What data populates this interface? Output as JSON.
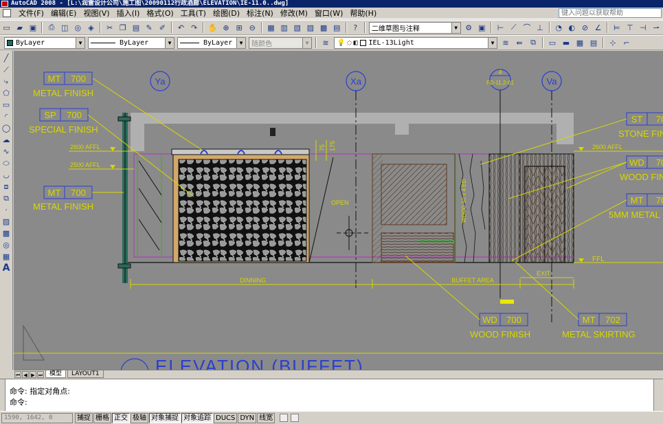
{
  "window": {
    "title": "AutoCAD 2008 - [L:\\润雷设计公司\\施工图\\20090112行政酒廊\\ELEVATION\\IE-11.0..dwg]"
  },
  "menu": [
    {
      "label": "文件(F)"
    },
    {
      "label": "编辑(E)"
    },
    {
      "label": "视图(V)"
    },
    {
      "label": "插入(I)"
    },
    {
      "label": "格式(O)"
    },
    {
      "label": "工具(T)"
    },
    {
      "label": "绘图(D)"
    },
    {
      "label": "标注(N)"
    },
    {
      "label": "修改(M)"
    },
    {
      "label": "窗口(W)"
    },
    {
      "label": "帮助(H)"
    }
  ],
  "help_search": {
    "placeholder": "键入问题以获取帮助"
  },
  "workspace_combo": {
    "value": "二维草图与注释"
  },
  "properties": {
    "color": "ByLayer",
    "linetype": "ByLayer",
    "lineweight": "ByLayer",
    "plotstyle": "随颜色",
    "layer": "IEL-13Light"
  },
  "drawing": {
    "grid_markers": [
      {
        "label": "Ya"
      },
      {
        "label": "Xa"
      },
      {
        "label": "Va"
      }
    ],
    "section_marker": {
      "top": "4",
      "bottom": "FD-11.2-01"
    },
    "tags_left": [
      {
        "code": "MT",
        "num": "700",
        "desc": "METAL FINISH"
      },
      {
        "code": "SP",
        "num": "700",
        "desc": "SPECIAL FINISH"
      },
      {
        "code": "MT",
        "num": "700",
        "desc": "METAL FINISH"
      }
    ],
    "tags_right": [
      {
        "code": "ST",
        "num": "70",
        "desc": "STONE FIN"
      },
      {
        "code": "WD",
        "num": "70",
        "desc": "WOOD FIN"
      },
      {
        "code": "MT",
        "num": "70",
        "desc": "5MM METAL"
      }
    ],
    "tags_bottom": [
      {
        "code": "WD",
        "num": "700",
        "desc": "WOOD FINISH"
      },
      {
        "code": "MT",
        "num": "702",
        "desc": "METAL SKIRTING"
      }
    ],
    "levels": {
      "left_2600": "2600 AFFL",
      "left_2500": "2500 AFFL",
      "right_2600": "2600 AFFL",
      "ffl": "FFL"
    },
    "dimensions": {
      "d1": "75",
      "d2": "175"
    },
    "labels": {
      "open": "OPEN",
      "dinning": "DINNING",
      "buffet_area": "BUFFET AREA",
      "exit": "EXIT",
      "vertical_note": "WOOD 50 x 4 ED"
    },
    "title": "ELEVATION (BUFFET)"
  },
  "tabs": [
    {
      "label": "模型",
      "active": true
    },
    {
      "label": "LAYOUT1",
      "active": false
    }
  ],
  "command": {
    "line1": "命令: 指定对角点:",
    "line2": "命令:"
  },
  "status": {
    "coords": "1590, 1642, 0",
    "buttons": [
      {
        "label": "捕捉",
        "on": false
      },
      {
        "label": "栅格",
        "on": false
      },
      {
        "label": "正交",
        "on": true
      },
      {
        "label": "极轴",
        "on": false
      },
      {
        "label": "对象捕捉",
        "on": true
      },
      {
        "label": "对象追踪",
        "on": true
      },
      {
        "label": "DUCS",
        "on": false
      },
      {
        "label": "DYN",
        "on": false
      },
      {
        "label": "线宽",
        "on": false
      }
    ]
  }
}
